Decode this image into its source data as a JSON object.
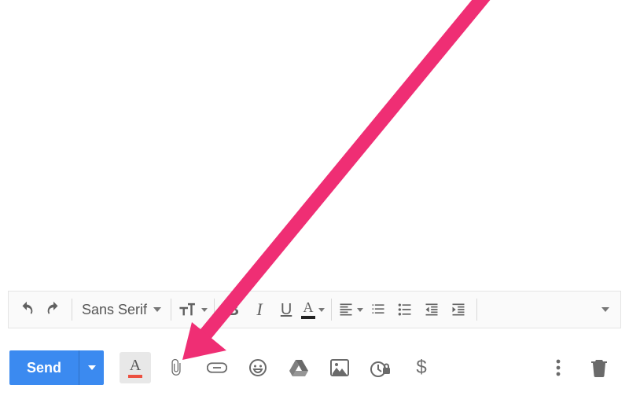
{
  "formatting": {
    "font_family": "Sans Serif"
  },
  "actions": {
    "send_label": "Send"
  }
}
